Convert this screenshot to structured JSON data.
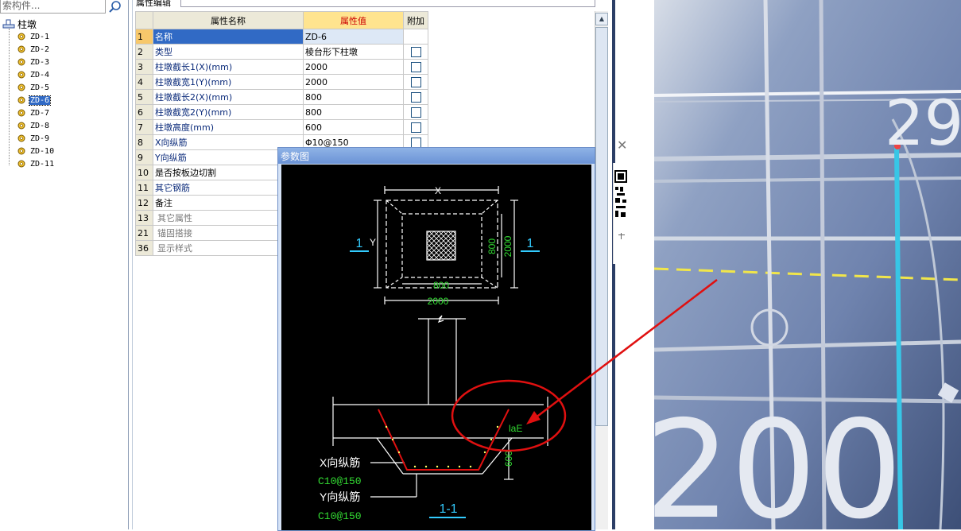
{
  "search": {
    "placeholder": "索构件..."
  },
  "tree": {
    "root_label": "柱墩",
    "items": [
      "ZD-1",
      "ZD-2",
      "ZD-3",
      "ZD-4",
      "ZD-5",
      "ZD-6",
      "ZD-7",
      "ZD-8",
      "ZD-9",
      "ZD-10",
      "ZD-11"
    ],
    "selected": "ZD-6"
  },
  "prop_panel": {
    "title": "属性编辑",
    "headers": {
      "name": "属性名称",
      "value": "属性值",
      "extra": "附加"
    },
    "rows": [
      {
        "num": "1",
        "name": "名称",
        "value": "ZD-6",
        "check": false
      },
      {
        "num": "2",
        "name": "类型",
        "value": "棱台形下柱墩",
        "check": true
      },
      {
        "num": "3",
        "name": "柱墩截长1(X)(mm)",
        "value": "2000",
        "check": true
      },
      {
        "num": "4",
        "name": "柱墩截宽1(Y)(mm)",
        "value": "2000",
        "check": true
      },
      {
        "num": "5",
        "name": "柱墩截长2(X)(mm)",
        "value": "800",
        "check": true
      },
      {
        "num": "6",
        "name": "柱墩截宽2(Y)(mm)",
        "value": "800",
        "check": true
      },
      {
        "num": "7",
        "name": "柱墩高度(mm)",
        "value": "600",
        "check": true
      },
      {
        "num": "8",
        "name": "X向纵筋",
        "value": "Φ10@150",
        "check": true
      },
      {
        "num": "9",
        "name": "Y向纵筋",
        "value": "",
        "check": false
      },
      {
        "num": "10",
        "name": "是否按板边切割",
        "value": "",
        "check": false
      },
      {
        "num": "11",
        "name": "其它钢筋",
        "value": "",
        "check": false
      },
      {
        "num": "12",
        "name": "备注",
        "value": "",
        "check": false
      },
      {
        "num": "13",
        "name": "其它属性",
        "value": "",
        "check": false
      },
      {
        "num": "21",
        "name": "锚固搭接",
        "value": "",
        "check": false
      },
      {
        "num": "36",
        "name": "显示样式",
        "value": "",
        "check": false
      }
    ]
  },
  "param_dialog": {
    "title": "参数图",
    "labels": {
      "x": "X",
      "y": "Y",
      "sec_left": "1",
      "sec_right": "1",
      "dim_800_v": "800",
      "dim_2000_v": "2000",
      "dim_800_h": "800",
      "dim_2000_h": "2000",
      "lae": "laE",
      "dim_600": "600",
      "x_bar_label": "X向纵筋",
      "x_bar_spec": "C10@150",
      "y_bar_label": "Y向纵筋",
      "y_bar_spec": "C10@150",
      "section_label": "1-1"
    }
  },
  "photo": {
    "number": "29",
    "big_text": "200"
  },
  "colors": {
    "selection": "#316ac5",
    "accent_red": "#e01010",
    "cad_green": "#33dd33",
    "cad_cyan": "#33ccff"
  }
}
